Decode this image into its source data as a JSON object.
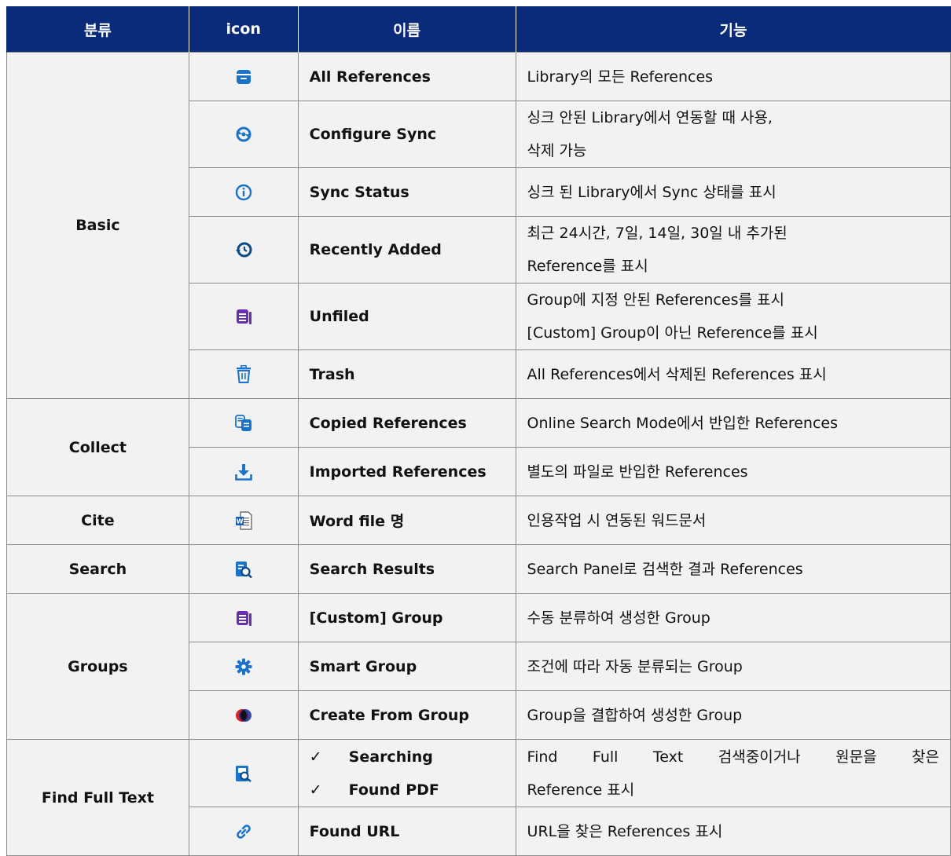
{
  "table": {
    "headers": [
      "분류",
      "icon",
      "이름",
      "기능"
    ],
    "groups": {
      "basic": "Basic",
      "collect": "Collect",
      "cite": "Cite",
      "search": "Search",
      "groups": "Groups",
      "find_full_text": "Find Full Text"
    },
    "rows": [
      {
        "icon": "library-box-icon",
        "name": "All References",
        "function": [
          "Library의 모든 References"
        ]
      },
      {
        "icon": "sync-config-icon",
        "name": "Configure Sync",
        "function": [
          "싱크 안된 Library에서 연동할 때 사용,",
          "삭제 가능"
        ]
      },
      {
        "icon": "info-icon",
        "name": "Sync Status",
        "function": [
          "싱크 된 Library에서 Sync 상태를 표시"
        ]
      },
      {
        "icon": "history-icon",
        "name": "Recently Added",
        "function": [
          "최근 24시간, 7일, 14일, 30일 내 추가된",
          "Reference를 표시"
        ]
      },
      {
        "icon": "group-list-icon",
        "name": "Unfiled",
        "function": [
          "Group에 지정 안된 References를 표시",
          "[Custom] Group이 아닌 Reference를 표시"
        ]
      },
      {
        "icon": "trash-icon",
        "name": "Trash",
        "function": [
          "All References에서 삭제된 References 표시"
        ]
      },
      {
        "icon": "copied-documents-icon",
        "name": "Copied References",
        "function": [
          "Online Search Mode에서 반입한 References"
        ]
      },
      {
        "icon": "download-icon",
        "name": "Imported References",
        "function": [
          "별도의 파일로 반입한 References"
        ]
      },
      {
        "icon": "word-document-icon",
        "name": "Word file 명",
        "function": [
          "인용작업 시 연동된 워드문서"
        ]
      },
      {
        "icon": "search-results-icon",
        "name": "Search Results",
        "function": [
          "Search Panel로 검색한 결과 References"
        ]
      },
      {
        "icon": "custom-group-icon",
        "name": "[Custom] Group",
        "function": [
          "수동 분류하여 생성한 Group"
        ]
      },
      {
        "icon": "smart-group-gear-icon",
        "name": "Smart Group",
        "function": [
          "조건에 따라 자동 분류되는 Group"
        ]
      },
      {
        "icon": "combine-circles-icon",
        "name": "Create From Group",
        "function": [
          "Group을 결합하여 생성한 Group"
        ]
      },
      {
        "icon": "find-text-search-icon",
        "name_items": [
          "Searching",
          "Found PDF"
        ],
        "check": "✓",
        "function": [
          "Find Full Text 검색중이거나 원문을 찾은",
          "Reference 표시"
        ]
      },
      {
        "icon": "link-icon",
        "name": "Found URL",
        "function": [
          "URL을 찾은 References 표시"
        ]
      }
    ]
  },
  "colors": {
    "header_bg": "#0a2a7a",
    "row_bg": "#f2f2f2",
    "icon_blue": "#1a73c9",
    "icon_purple": "#6a2fb0",
    "icon_navy": "#0a4a86"
  }
}
